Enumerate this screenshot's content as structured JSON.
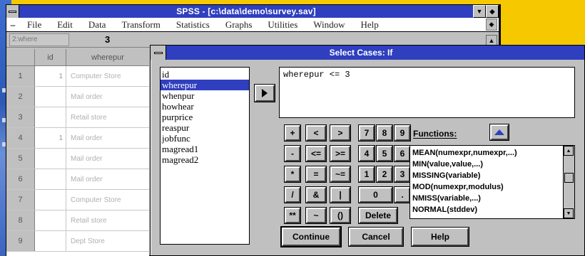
{
  "main_window": {
    "title": "SPSS - [c:\\data\\demo\\survey.sav]",
    "menu": [
      "File",
      "Edit",
      "Data",
      "Transform",
      "Statistics",
      "Graphs",
      "Utilities",
      "Window",
      "Help"
    ]
  },
  "cellbar": {
    "reference": "2:where",
    "value": "3"
  },
  "grid": {
    "headers": {
      "id": "id",
      "wherepur": "wherepur"
    },
    "rows": [
      {
        "num": "1",
        "id": "1",
        "value": "Computer Store"
      },
      {
        "num": "2",
        "id": "",
        "value": "Mail order"
      },
      {
        "num": "3",
        "id": "",
        "value": "Retail store"
      },
      {
        "num": "4",
        "id": "1",
        "value": "Mail order"
      },
      {
        "num": "5",
        "id": "",
        "value": "Mail order"
      },
      {
        "num": "6",
        "id": "",
        "value": "Mail order"
      },
      {
        "num": "7",
        "id": "",
        "value": "Computer Store"
      },
      {
        "num": "8",
        "id": "",
        "value": "Retail store"
      },
      {
        "num": "9",
        "id": "",
        "value": "Dept Store"
      }
    ]
  },
  "dialog": {
    "title": "Select Cases: If",
    "variables": [
      "id",
      "wherepur",
      "whenpur",
      "howhear",
      "purprice",
      "reaspur",
      "jobfunc",
      "magread1",
      "magread2"
    ],
    "selected_variable": "wherepur",
    "expression": "wherepur <= 3",
    "keypad": [
      [
        "+",
        "<",
        ">",
        "7",
        "8",
        "9"
      ],
      [
        "-",
        "<=",
        ">=",
        "4",
        "5",
        "6"
      ],
      [
        "*",
        "=",
        "~=",
        "1",
        "2",
        "3"
      ],
      [
        "/",
        "&",
        "|",
        "0",
        "."
      ],
      [
        "**",
        "~",
        "()",
        "Delete"
      ]
    ],
    "functions_label": "Functions:",
    "functions": [
      "MEAN(numexpr,numexpr,...)",
      "MIN(value,value,...)",
      "MISSING(variable)",
      "MOD(numexpr,modulus)",
      "NMISS(variable,...)",
      "NORMAL(stddev)"
    ],
    "buttons": {
      "continue": "Continue",
      "cancel": "Cancel",
      "help": "Help"
    }
  },
  "colors": {
    "titlebar": "#2f3fbf",
    "desktop": "#f5c800",
    "face": "#c0c0c0"
  }
}
